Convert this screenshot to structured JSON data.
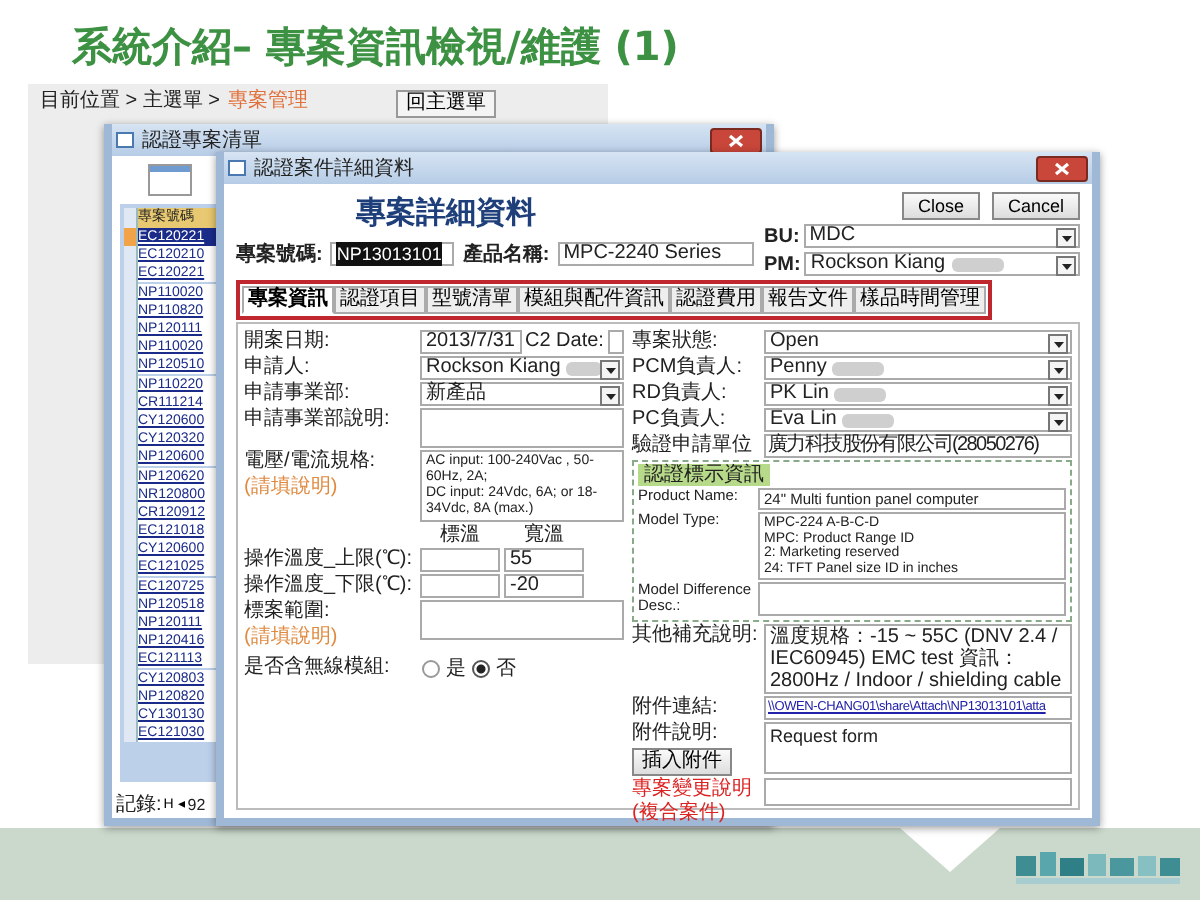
{
  "slide": {
    "title": "系統介紹– 專案資訊檢視/維護 (1)"
  },
  "app": {
    "breadcrumb_path": "目前位置 > 主選單 >",
    "breadcrumb_current": "專案管理",
    "home_button": "回主選單"
  },
  "list_window": {
    "title": "認證專案清單",
    "column": "專案號碼",
    "rows": [
      {
        "code": "EC120221",
        "selected": true
      },
      {
        "code": "EC120210",
        "selected": false
      },
      {
        "code": "EC120221",
        "selected": false
      },
      {
        "code": "NP110020",
        "selected": false
      },
      {
        "code": "NP110820",
        "selected": false
      },
      {
        "code": "NP120111",
        "selected": false
      },
      {
        "code": "NP110020",
        "selected": false
      },
      {
        "code": "NP120510",
        "selected": false
      },
      {
        "code": "NP110220",
        "selected": false
      },
      {
        "code": "CR111214",
        "selected": false
      },
      {
        "code": "CY120600",
        "selected": false
      },
      {
        "code": "CY120320",
        "selected": false
      },
      {
        "code": "NP120600",
        "selected": false
      },
      {
        "code": "NP120620",
        "selected": false
      },
      {
        "code": "NR120800",
        "selected": false
      },
      {
        "code": "CR120912",
        "selected": false
      },
      {
        "code": "EC121018",
        "selected": false
      },
      {
        "code": "CY120600",
        "selected": false
      },
      {
        "code": "EC121025",
        "selected": false
      },
      {
        "code": "EC120725",
        "selected": false
      },
      {
        "code": "NP120518",
        "selected": false
      },
      {
        "code": "NP120111",
        "selected": false
      },
      {
        "code": "NP120416",
        "selected": false
      },
      {
        "code": "EC121113",
        "selected": false
      },
      {
        "code": "CY120803",
        "selected": false
      },
      {
        "code": "NP120820",
        "selected": false
      },
      {
        "code": "CY130130",
        "selected": false
      },
      {
        "code": "EC121030",
        "selected": false
      }
    ],
    "record_label": "記錄:",
    "record_nav": "H ◂",
    "record_count": "92"
  },
  "detail_window": {
    "title": "認證案件詳細資料",
    "heading": "專案詳細資料",
    "project_no": {
      "label": "專案號碼:",
      "value": "NP13013101"
    },
    "product_name": {
      "label": "產品名稱:",
      "value": "MPC-2240 Series"
    },
    "buttons": [
      "Close",
      "Cancel"
    ],
    "bu": {
      "label": "BU:",
      "value": "MDC",
      "redacted": false
    },
    "pm": {
      "label": "PM:",
      "value": "Rockson  Kiang",
      "redacted": true
    },
    "tabs": [
      {
        "label": "專案資訊",
        "selected": true
      },
      {
        "label": "認證項目",
        "selected": false
      },
      {
        "label": "型號清單",
        "selected": false
      },
      {
        "label": "模組與配件資訊",
        "selected": false
      },
      {
        "label": "認證費用",
        "selected": false
      },
      {
        "label": "報告文件",
        "selected": false
      },
      {
        "label": "樣品時間管理",
        "selected": false
      }
    ],
    "open_date": {
      "label": "開案日期:",
      "value": "2013/7/31"
    },
    "c2_date": {
      "label": "C2 Date:"
    },
    "left_fields": [
      {
        "label": "申請人:",
        "value": "Rockson  Kiang",
        "redacted": true
      },
      {
        "label": "申請事業部:",
        "value": "新產品",
        "redacted": false
      }
    ],
    "department_desc": {
      "label": "申請事業部說明:"
    },
    "power": {
      "label": "電壓/電流規格:",
      "note": "(請填說明)",
      "lines": [
        "AC input: 100-240Vac , 50-60Hz, 2A;",
        "DC input: 24Vdc, 6A; or 18-34Vdc, 8A (max.)"
      ]
    },
    "temp_headers": [
      "標溫",
      "寬溫"
    ],
    "temps": [
      {
        "label": "操作溫度_上限(℃):",
        "wide": "55"
      },
      {
        "label": "操作溫度_下限(℃):",
        "wide": "-20"
      }
    ],
    "scope": {
      "label": "標案範圍:",
      "note": "(請填說明)"
    },
    "wireless": {
      "label": "是否含無線模組:",
      "options": [
        {
          "label": "是",
          "selected": false
        },
        {
          "label": "否",
          "selected": true
        }
      ]
    },
    "right_fields": [
      {
        "kind": "select",
        "label": "專案狀態:",
        "value": "Open",
        "redacted": false
      },
      {
        "kind": "select",
        "label": "PCM負責人:",
        "value": "Penny",
        "redacted": true
      },
      {
        "kind": "select",
        "label": "RD負責人:",
        "value": "PK Lin",
        "redacted": true
      },
      {
        "kind": "select",
        "label": "PC負責人:",
        "value": "Eva Lin",
        "redacted": true
      },
      {
        "kind": "text",
        "label": "驗證申請單位",
        "value": "廣力科技股份有限公司(28050276)",
        "redacted": false
      }
    ],
    "cert_group": {
      "title": "認證標示資訊",
      "product_name": {
        "label": "Product Name:",
        "value": "24\" Multi funtion panel computer"
      },
      "model_type": {
        "label": "Model Type:",
        "lines": [
          "MPC-224 A-B-C-D",
          "MPC: Product Range ID",
          "2: Marketing reserved",
          "24: TFT Panel size ID in inches"
        ]
      },
      "model_diff": {
        "label": "Model Difference Desc.:"
      }
    },
    "other": {
      "label": "其他補充說明:",
      "value": "溫度規格：-15 ~ 55C (DNV 2.4 / IEC60945) EMC test 資訊：2800Hz / Indoor / shielding cable"
    },
    "attachment_link": {
      "label": "附件連結:",
      "value": "\\\\OWEN-CHANG01\\share\\Attach\\NP13013101\\atta"
    },
    "attachment_desc": {
      "label": "附件說明:",
      "value": "Request form"
    },
    "insert_button": "插入附件",
    "change_note": {
      "label_lines": [
        "專案變更說明",
        "(複合案件)"
      ]
    }
  }
}
